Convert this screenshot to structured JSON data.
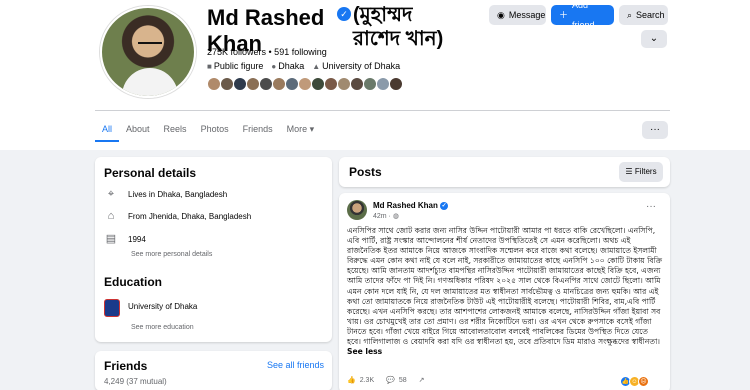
{
  "profile": {
    "name": "Md Rashed Khan",
    "alt_name": "(মুহাম্মদ রাশেদ খান)",
    "stats": "275K followers • 591 following",
    "meta": [
      {
        "icon": "briefcase-icon",
        "label": "Public figure"
      },
      {
        "icon": "location-pin-icon",
        "label": "Dhaka"
      },
      {
        "icon": "graduation-cap-icon",
        "label": "University of Dhaka"
      }
    ],
    "friend_avatar_colors": [
      "#b08a6a",
      "#6b5a4a",
      "#2f3b4d",
      "#8a6f55",
      "#4c4c4c",
      "#9a7b5e",
      "#5c6b7a",
      "#c09a7a",
      "#3d4a3a",
      "#7a5a48",
      "#a08a70",
      "#5a4a40",
      "#6a7a6a",
      "#8a9aaa",
      "#4a3a30"
    ]
  },
  "actions": {
    "message": "Message",
    "add_friend": "Add friend",
    "search": "Search"
  },
  "tabs": [
    "All",
    "About",
    "Reels",
    "Photos",
    "Friends",
    "More ▾"
  ],
  "personal": {
    "title": "Personal details",
    "lives": "Lives in Dhaka, Bangladesh",
    "from": "From Jhenida, Dhaka, Bangladesh",
    "year": "1994",
    "see_more": "See more personal details"
  },
  "education": {
    "title": "Education",
    "school": "University of Dhaka",
    "see_more": "See more education"
  },
  "friends": {
    "title": "Friends",
    "see_all": "See all friends",
    "count": "4,249 (37 mutual)"
  },
  "posts": {
    "title": "Posts",
    "filters": "Filters"
  },
  "post": {
    "author": "Md Rashed Khan",
    "time": "42m ·",
    "body": "এনসিপির সাথে জোট করার জন্য নাসির উদ্দিন পাটোয়ারী আমার পা ধরতে বাকি রেখেছিলো। এনসিপি, এবি পার্টি, রাষ্ট্র সংস্কার আন্দোলনের শীর্ষ নেতাদের উপস্থিতিতেই সে এমন করেছিলো। অথচ এই রাজনৈতিক ইতর আমাকে নিয়ে আজকে সাংবাদিক সম্মেলন করে বাজে কথা বলেছে। জামায়াতে ইসলামী বিরুদ্ধে এমন কোন কথা নাই যে বলে নাই, সরকারীতে জামায়াতের কাছে এনসিপি ১০০ কোটি টাকায় বিক্রি হয়েছে। আমি জানতাম আদর্শচ্যুত বামপন্থির নাসিরউদ্দিন পাটোয়ারী জামায়াতের কাছেই বিক্রি হবে, এজন্য আমি তাদের ফাঁদে পা দিই নি। গণঅধিকার পরিষদ ২০২৫ সাল থেকে বিএনপির সাথে জোটে ছিলো। আমি এমন কোন দলে যাই নি, যে দল জামায়াতের মত স্বাধীনতা সার্বভৌমত্ব ও মানচিত্রের জন্য হুমকি। আর এই কথা তো জামায়াতকে নিয়ে রাজনৈতিক টাউট এই পাটোয়ারীই বলেছে। পাটোয়ারী শিবির, বাম,এবি পার্টি করেছে। এখন এনসিপি করছে। তার আশপাশের লোকজনই আমাকে বলেছে, নাসিরউদ্দিন গাঁজা ইয়াবা সব খায়। ওর চোখমুখেই তার তো প্রমাণ। ওর শরীর নিকোটিনে ভরা। ওর এখন থেকে রুপসাকে বসেই গাঁজা টানতে হবে। গাঁজা খেয়ে বাইরে গিয়ে আবোলতাবোল বলবেই পাবলিকের ডিমের উপস্থিত দিতে যেতে হবে। গালিগালাজ ও বেয়াদবি করা যদি ওর স্বাধীনতা হয়, তবে প্রতিবাদে ডিম মারাও সংক্ষুব্ধদের স্বাধীনতা।",
    "see_less": "See less",
    "likes": "2.3K",
    "comments": "58"
  },
  "colors": {
    "accent": "#1877f2",
    "background": "#f0f2f5",
    "card": "#ffffff"
  }
}
